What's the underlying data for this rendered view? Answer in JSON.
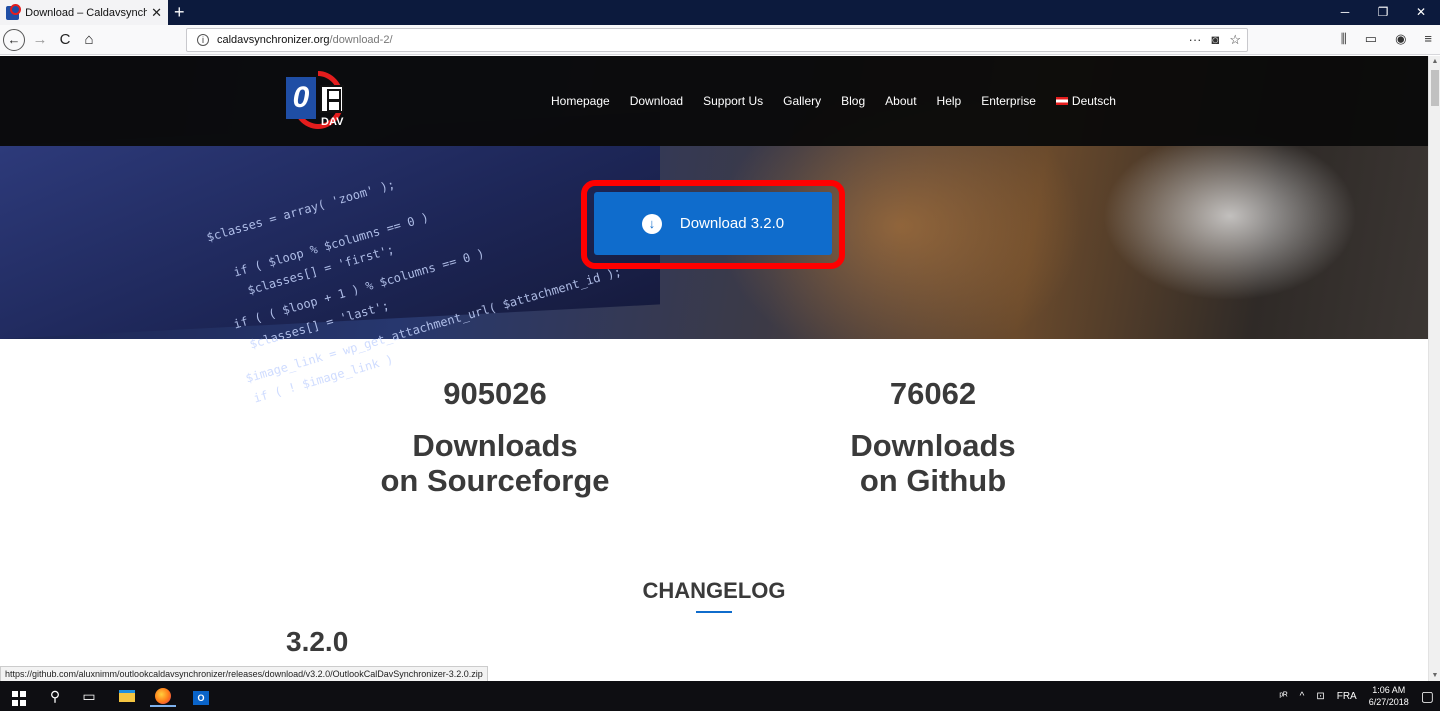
{
  "browser": {
    "tab_title": "Download – Caldavsynchronizer",
    "tab_close": "✕",
    "new_tab": "+",
    "window_controls": {
      "minimize": "─",
      "restore": "❐",
      "close": "✕"
    },
    "nav": {
      "back": "←",
      "forward": "→",
      "reload": "C",
      "home": "⌂"
    },
    "url_domain": "caldavsynchronizer.org",
    "url_path": "/download-2/",
    "url_icons": {
      "more": "···",
      "pocket": "◙",
      "bookmark": "☆"
    },
    "toolbar_right": {
      "library": "⫼",
      "sidebar": "▭",
      "account": "◉",
      "menu": "≡"
    },
    "status_url": "https://github.com/aluxnimm/outlookcaldavsynchronizer/releases/download/v3.2.0/OutlookCalDavSynchronizer-3.2.0.zip"
  },
  "site": {
    "logo_letter": "0",
    "logo_sub": "DAV",
    "menu": [
      "Homepage",
      "Download",
      "Support Us",
      "Gallery",
      "Blog",
      "About",
      "Help",
      "Enterprise",
      "Deutsch"
    ],
    "hero_code": [
      "$classes = array( 'zoom' );",
      "if ( $loop % $columns == 0 )",
      "$classes[] = 'first';",
      "if ( ( $loop + 1 ) % $columns == 0 )",
      "$classes[] = 'last';",
      "$image_link = wp_get_attachment_url( $attachment_id );",
      "if ( ! $image_link )"
    ],
    "download_button": "Download 3.2.0",
    "download_icon": "↓",
    "stats": {
      "sourceforge": {
        "count": "905026",
        "line1": "Downloads",
        "line2": "on Sourceforge"
      },
      "github": {
        "count": "76062",
        "line1": "Downloads",
        "line2": "on Github"
      }
    },
    "changelog_title": "CHANGELOG",
    "version": "3.2.0"
  },
  "taskbar": {
    "search": "⚲",
    "taskview": "▭",
    "outlook_letter": "O",
    "tray": {
      "people": "ᵖᴿ",
      "chevron": "^",
      "network": "⊡",
      "lang": "FRA",
      "notifications": "▢"
    },
    "time": "1:06 AM",
    "date": "6/27/2018"
  },
  "colors": {
    "accent": "#0f6ccc",
    "highlight": "#ff0000",
    "header_bg": "#0a0a0a",
    "text": "#3a3a3a"
  }
}
